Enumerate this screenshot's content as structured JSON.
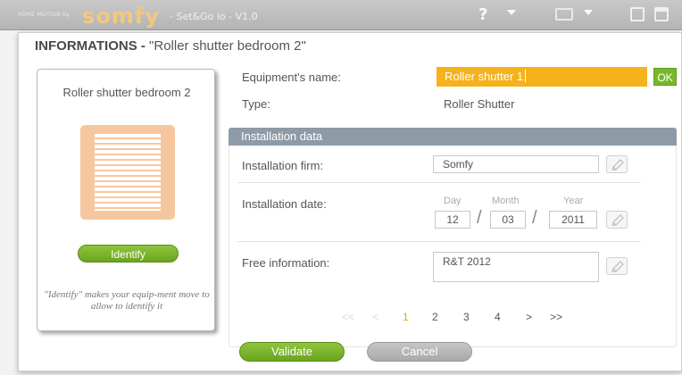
{
  "app": {
    "brand_prefix": "HOME MOTION by",
    "brand": "somfy",
    "version": "- Set&Go io - V1.0",
    "help": "?"
  },
  "dialog": {
    "title_bold": "INFORMATIONS -",
    "title_rest": "\"Roller shutter bedroom 2\""
  },
  "card": {
    "title": "Roller shutter bedroom 2",
    "identify_label": "Identify",
    "note": "\"Identify\" makes your equip-ment move to allow to identify it"
  },
  "fields": {
    "name_label": "Equipment's name:",
    "name_value": "Roller shutter 1",
    "ok_label": "OK",
    "type_label": "Type:",
    "type_value": "Roller Shutter"
  },
  "installation": {
    "header": "Installation data",
    "firm_label": "Installation firm:",
    "firm_value": "Somfy",
    "date_label": "Installation date:",
    "day_hint": "Day",
    "month_hint": "Month",
    "year_hint": "Year",
    "day": "12",
    "month": "03",
    "year": "2011",
    "separator": "/",
    "free_label": "Free information:",
    "free_value": "R&T 2012"
  },
  "pager": {
    "first": "<<",
    "prev": "<",
    "pages": [
      "1",
      "2",
      "3",
      "4"
    ],
    "current": "1",
    "next": ">",
    "last": ">>"
  },
  "actions": {
    "validate_label": "Validate",
    "cancel_label": "Cancel"
  },
  "colors": {
    "accent_orange": "#f5b21a",
    "green": "#77b82a",
    "section_header": "#8e9aa6",
    "shutter": "#f6c79f"
  }
}
